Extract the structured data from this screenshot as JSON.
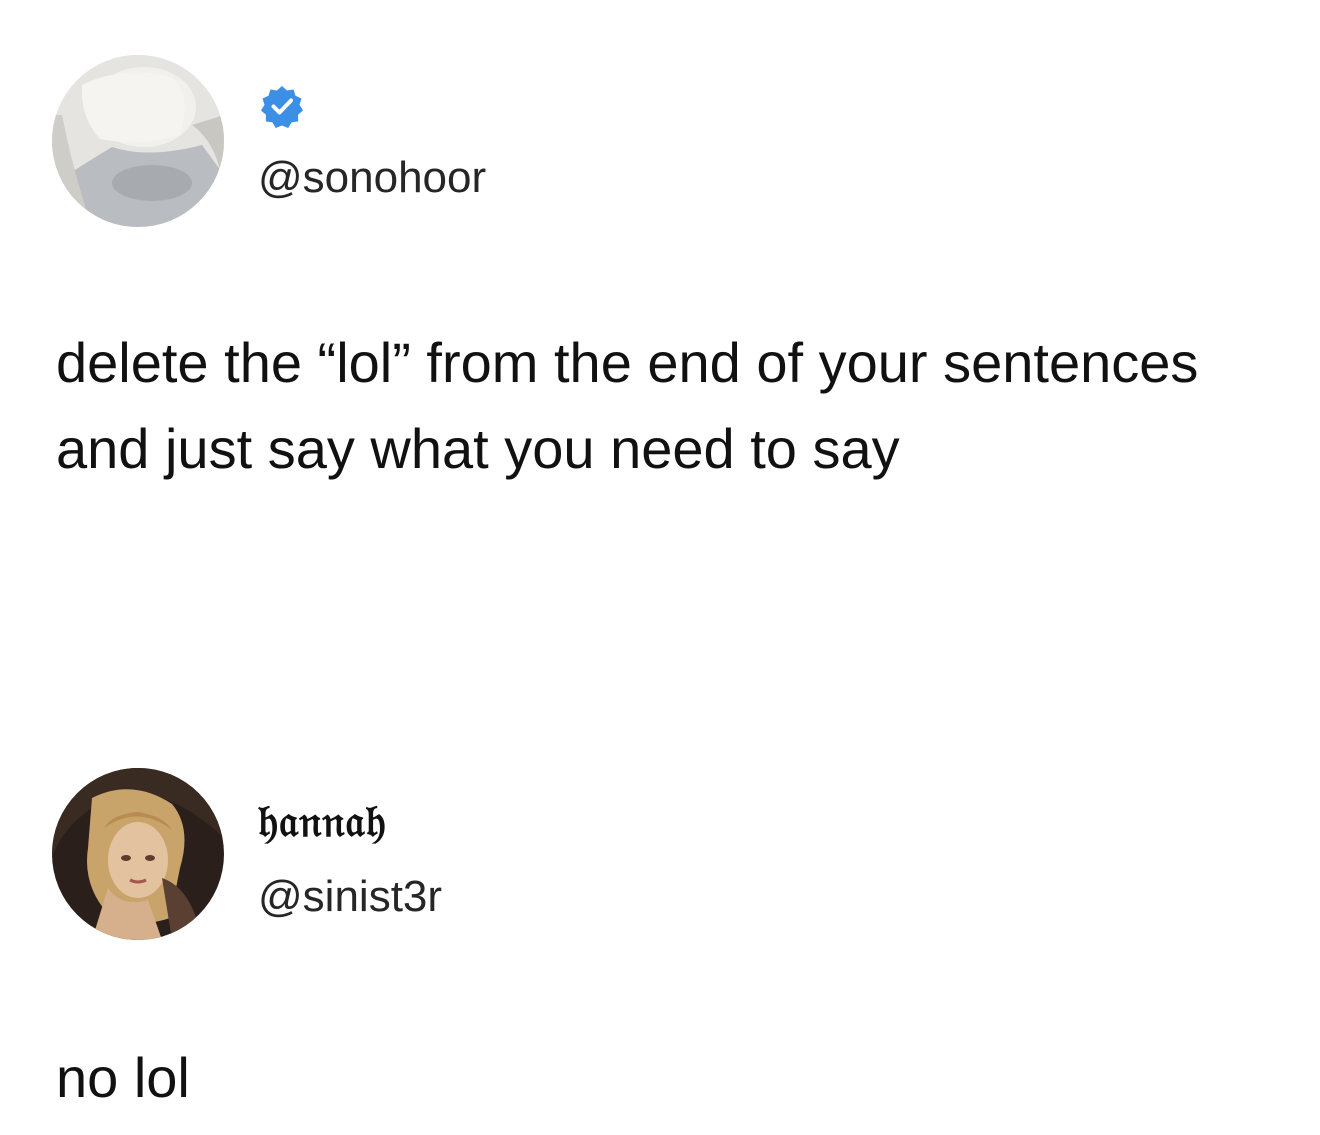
{
  "tweets": [
    {
      "display_name": "",
      "handle": "@sonohoor",
      "verified": true,
      "text": "delete the “lol” from the end of your sentences and just say what you need to say"
    },
    {
      "display_name": "𝔥𝔞𝔫𝔫𝔞𝔥",
      "handle": "@sinist3r",
      "verified": false,
      "text": "no lol"
    }
  ],
  "colors": {
    "verified_badge": "#3b8fe5",
    "text": "#111111",
    "background": "#ffffff"
  },
  "icons": {
    "verified": "verified-check-icon"
  }
}
